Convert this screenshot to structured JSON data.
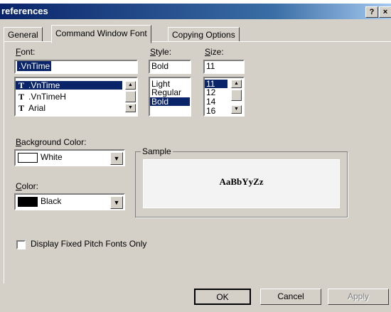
{
  "window": {
    "title": "references",
    "help_label": "?",
    "close_label": "×"
  },
  "tabs": [
    {
      "label": "General"
    },
    {
      "label": "Command Window Font"
    },
    {
      "label": "Copying Options"
    }
  ],
  "font": {
    "label": "Font:",
    "value": ".VnTime",
    "items": [
      {
        "name": ".VnTime",
        "selected": true
      },
      {
        "name": ".VnTimeH"
      },
      {
        "name": "Arial"
      }
    ]
  },
  "style": {
    "label": "Style:",
    "value": "Bold",
    "items": [
      "Light",
      "Regular",
      "Bold"
    ]
  },
  "size": {
    "label": "Size:",
    "value": "11",
    "items": [
      "11",
      "12",
      "14",
      "16"
    ]
  },
  "background_color": {
    "label": "Background Color:",
    "value": "White",
    "swatch": "#ffffff"
  },
  "color": {
    "label": "Color:",
    "value": "Black",
    "swatch": "#000000"
  },
  "sample": {
    "label": "Sample",
    "text": "AaBbYyZz"
  },
  "fixed_pitch": {
    "label": "Display Fixed Pitch Fonts Only",
    "checked": false
  },
  "buttons": {
    "ok": "OK",
    "cancel": "Cancel",
    "apply": "Apply"
  },
  "colors": {
    "dialog_bg": "#d4d0c8",
    "selection": "#0a246a",
    "title_gradient_start": "#0a246a"
  }
}
